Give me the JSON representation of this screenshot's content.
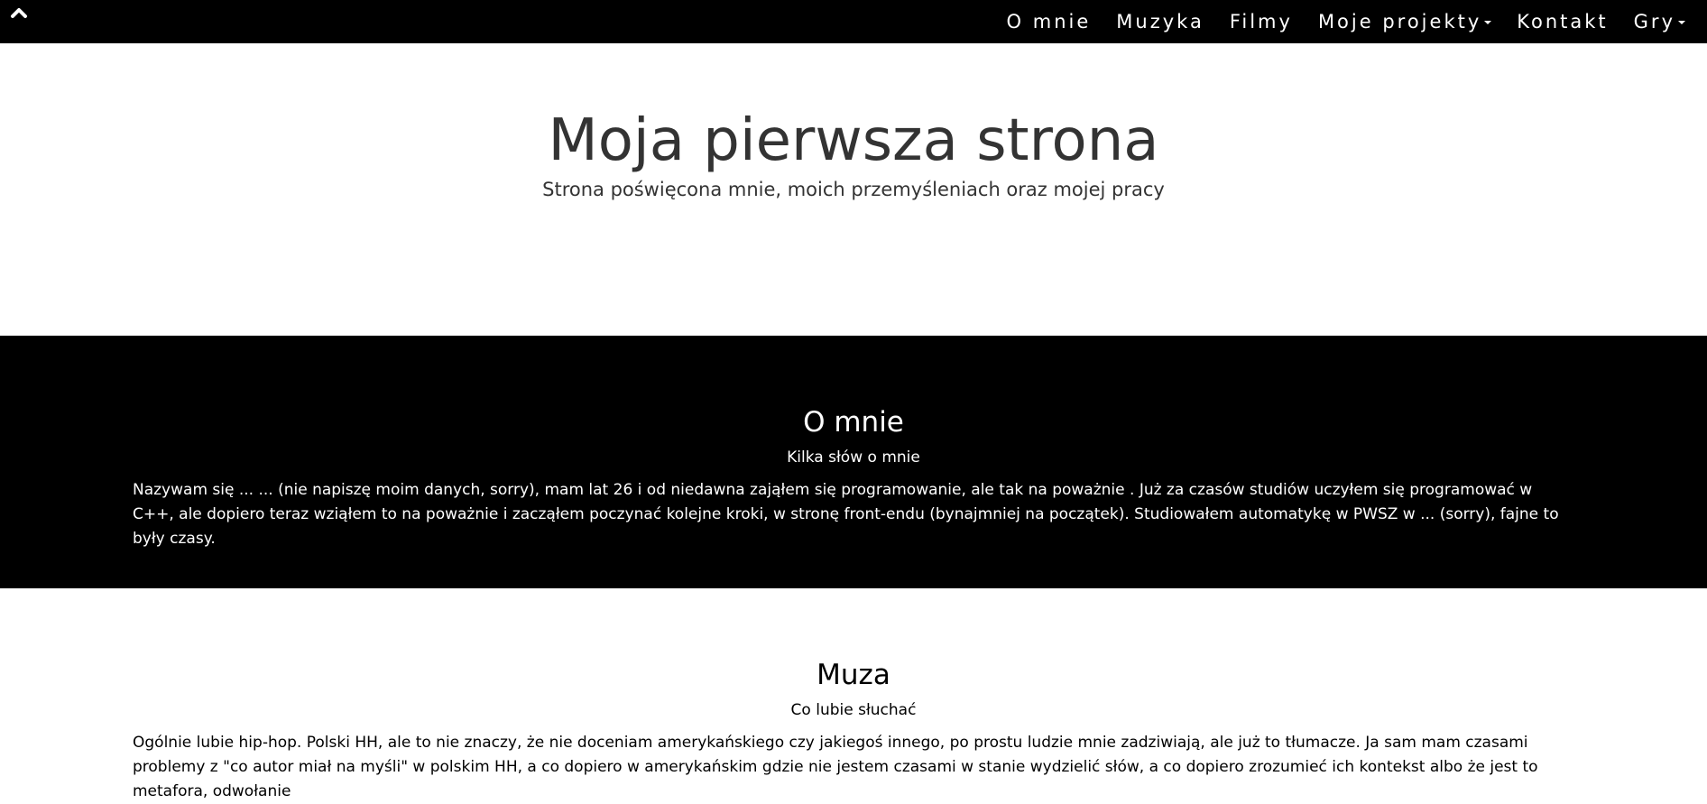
{
  "navbar": {
    "logo_icon": "chevron-up-icon",
    "items": [
      {
        "label": "O mnie",
        "dropdown": false
      },
      {
        "label": "Muzyka",
        "dropdown": false
      },
      {
        "label": "Filmy",
        "dropdown": false
      },
      {
        "label": "Moje projekty",
        "dropdown": true
      },
      {
        "label": "Kontakt",
        "dropdown": false
      },
      {
        "label": "Gry",
        "dropdown": true
      }
    ]
  },
  "hero": {
    "title": "Moja pierwsza strona",
    "subtitle": "Strona poświęcona mnie, moich przemyśleniach oraz mojej pracy"
  },
  "about": {
    "title": "O mnie",
    "subtitle": "Kilka słów o mnie",
    "text": "Nazywam się ... ... (nie napiszę moim danych, sorry), mam lat 26 i od niedawna zająłem się programowanie, ale tak na poważnie . Już za czasów studiów uczyłem się programować w C++, ale dopiero teraz wziąłem to na poważnie i zacząłem poczynać kolejne kroki, w stronę front-endu (bynajmniej na początek). Studiowałem automatykę w PWSZ w ... (sorry), fajne to były czasy."
  },
  "music": {
    "title": "Muza",
    "subtitle": "Co lubie słuchać",
    "text": "Ogólnie lubie hip-hop. Polski HH, ale to nie znaczy, że nie doceniam amerykańskiego czy jakiegoś innego, po prostu ludzie mnie zadziwiają, ale już to tłumacze. Ja sam mam czasami problemy z \"co autor miał na myśli\" w polskim HH, a co dopiero w amerykańskim gdzie nie jestem czasami w stanie wydzielić słów, a co dopiero zrozumieć ich kontekst albo że jest to metafora, odwołanie"
  },
  "colors": {
    "dark_bg": "#000000",
    "light_bg": "#ffffff",
    "text_light": "#ffffff",
    "text_dark": "#333333"
  }
}
